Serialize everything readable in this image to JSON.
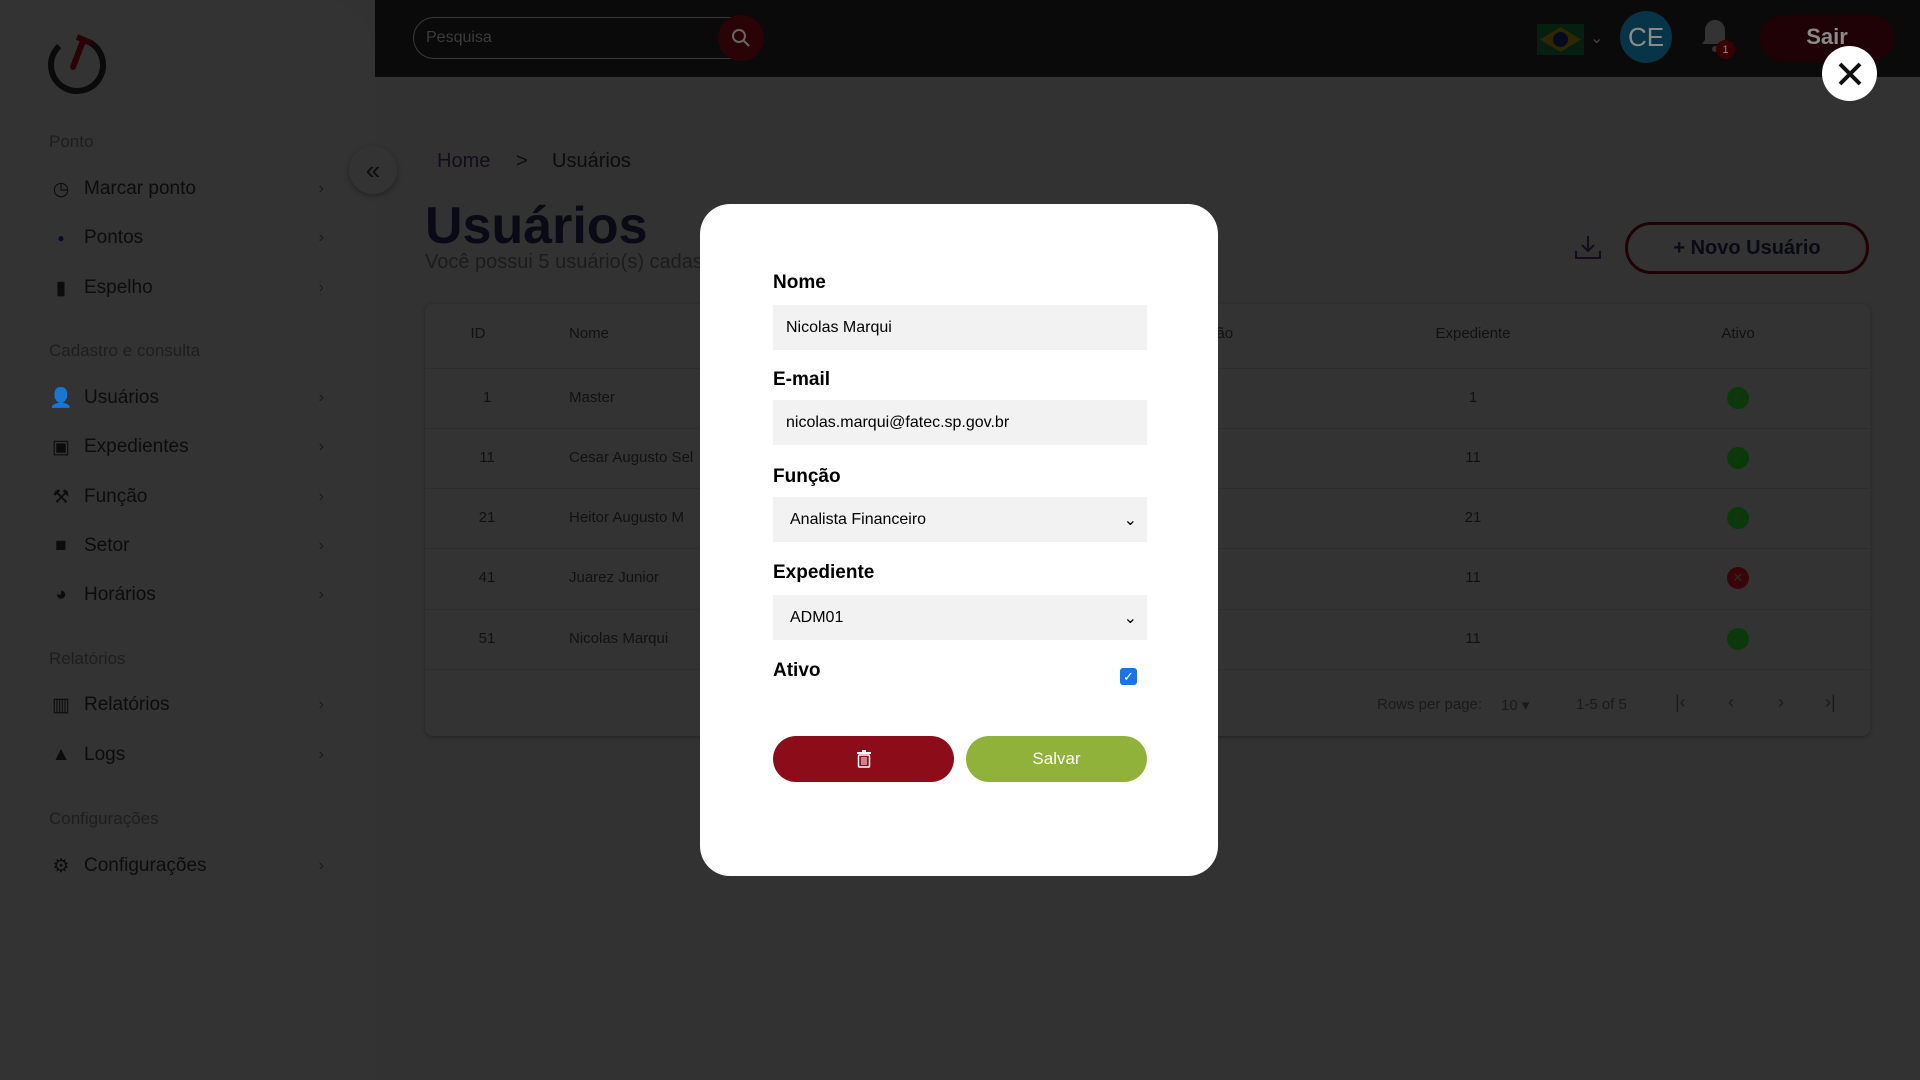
{
  "sidebar": {
    "sections": [
      {
        "title": "Ponto",
        "items": [
          {
            "label": "Marcar ponto",
            "icon": "clock-icon"
          },
          {
            "label": "Pontos",
            "icon": "dot-icon"
          },
          {
            "label": "Espelho",
            "icon": "book-icon"
          }
        ]
      },
      {
        "title": "Cadastro e consulta",
        "items": [
          {
            "label": "Usuários",
            "icon": "user-icon"
          },
          {
            "label": "Expedientes",
            "icon": "clipboard-check-icon"
          },
          {
            "label": "Função",
            "icon": "hammer-icon"
          },
          {
            "label": "Setor",
            "icon": "briefcase-icon"
          },
          {
            "label": "Horários",
            "icon": "user-clock-icon"
          }
        ]
      },
      {
        "title": "Relatórios",
        "items": [
          {
            "label": "Relatórios",
            "icon": "books-icon"
          },
          {
            "label": "Logs",
            "icon": "shapes-icon"
          }
        ]
      },
      {
        "title": "Configurações",
        "items": [
          {
            "label": "Configurações",
            "icon": "gear-icon"
          }
        ]
      }
    ]
  },
  "header": {
    "search_placeholder": "Pesquisa",
    "avatar": "CE",
    "notifications": "1",
    "logout": "Sair",
    "language": "pt-BR"
  },
  "breadcrumb": {
    "home": "Home",
    "separator": ">",
    "current": "Usuários"
  },
  "page": {
    "title": "Usuários",
    "subtitle": "Você possui 5 usuário(s) cadastr",
    "new_button": "+ Novo Usuário"
  },
  "table": {
    "headers": {
      "id": "ID",
      "nome": "Nome",
      "funcao": "Função",
      "expediente": "Expediente",
      "ativo": "Ativo"
    },
    "rows": [
      {
        "id": "1",
        "nome": "Master",
        "expediente": "1",
        "ativo": true
      },
      {
        "id": "11",
        "nome": "Cesar Augusto Sel",
        "expediente": "11",
        "ativo": true
      },
      {
        "id": "21",
        "nome": "Heitor Augusto M",
        "expediente": "21",
        "ativo": true
      },
      {
        "id": "41",
        "nome": "Juarez Junior",
        "expediente": "11",
        "ativo": false
      },
      {
        "id": "51",
        "nome": "Nicolas Marqui",
        "expediente": "11",
        "ativo": true
      }
    ],
    "pagination": {
      "rows_label": "Rows per page:",
      "rows_value": "10",
      "range": "1-5 of 5"
    }
  },
  "modal": {
    "nome_label": "Nome",
    "nome_value": "Nicolas Marqui",
    "email_label": "E-mail",
    "email_value": "nicolas.marqui@fatec.sp.gov.br",
    "funcao_label": "Função",
    "funcao_value": "Analista Financeiro",
    "expediente_label": "Expediente",
    "expediente_value": "ADM01",
    "ativo_label": "Ativo",
    "ativo_checked": true,
    "save_label": "Salvar"
  },
  "colors": {
    "brand_red": "#8c0d19",
    "save_green": "#90b23b",
    "ok_green": "#2e8b2e",
    "error_red": "#d11a2a"
  }
}
